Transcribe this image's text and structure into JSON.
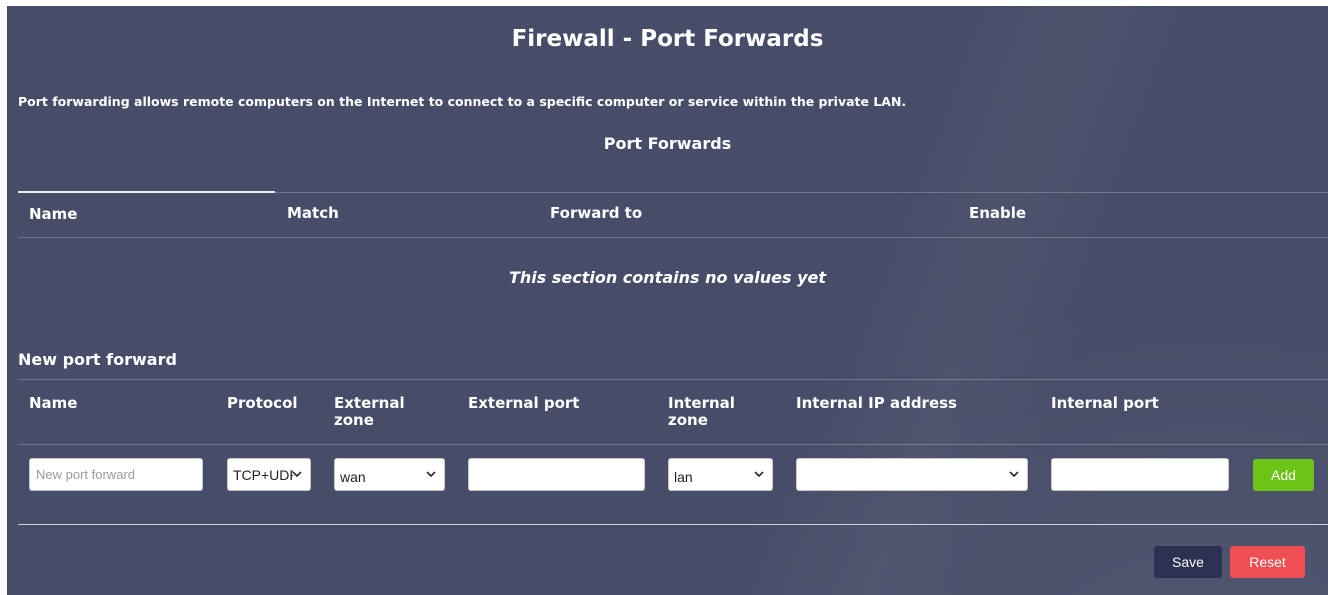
{
  "page": {
    "title": "Firewall - Port Forwards",
    "description": "Port forwarding allows remote computers on the Internet to connect to a specific computer or service within the private LAN."
  },
  "port_forwards": {
    "title": "Port Forwards",
    "columns": [
      "Name",
      "Match",
      "Forward to",
      "Enable"
    ],
    "empty_message": "This section contains no values yet"
  },
  "new_forward": {
    "title": "New port forward",
    "columns": {
      "name": "Name",
      "protocol": "Protocol",
      "external_zone_line1": "External",
      "external_zone_line2": "zone",
      "external_port": "External port",
      "internal_zone_line1": "Internal",
      "internal_zone_line2": "zone",
      "internal_ip": "Internal IP address",
      "internal_port": "Internal port"
    },
    "name_placeholder": "New port forward",
    "name_value": "",
    "protocol_value": "TCP+UDP",
    "external_zone_value": "wan",
    "external_port_value": "",
    "internal_zone_value": "lan",
    "internal_ip_value": "",
    "internal_port_value": "",
    "add_label": "Add"
  },
  "footer": {
    "save_label": "Save",
    "reset_label": "Reset"
  },
  "colors": {
    "panel_bg": "#474c68",
    "add_button": "#6cc417",
    "save_button": "#2b3150",
    "reset_button": "#f04e55"
  },
  "icons": {
    "select_arrow": "chevron-down-icon"
  }
}
